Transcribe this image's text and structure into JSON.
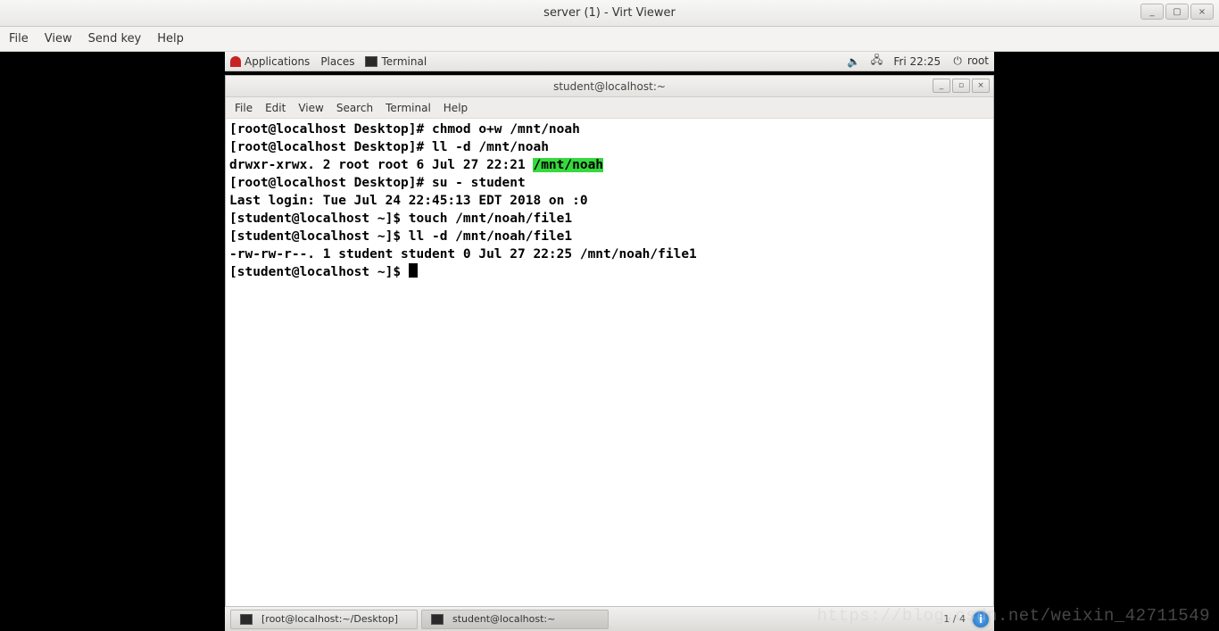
{
  "virt_viewer": {
    "title": "server (1) - Virt Viewer",
    "menus": {
      "file": "File",
      "view": "View",
      "send_key": "Send key",
      "help": "Help"
    },
    "controls": {
      "min": "_",
      "max": "▢",
      "close": "×"
    }
  },
  "gnome_top": {
    "applications": "Applications",
    "places": "Places",
    "terminal": "Terminal",
    "clock": "Fri 22:25",
    "user": "root"
  },
  "terminal": {
    "title": "student@localhost:~",
    "menus": {
      "file": "File",
      "edit": "Edit",
      "view": "View",
      "search": "Search",
      "terminal": "Terminal",
      "help": "Help"
    },
    "controls": {
      "min": "_",
      "max": "▫",
      "close": "×"
    },
    "lines": {
      "l1": "[root@localhost Desktop]# chmod o+w /mnt/noah",
      "l2": "[root@localhost Desktop]# ll -d /mnt/noah",
      "l3a": "drwxr-xrwx. 2 root root 6 Jul 27 22:21 ",
      "l3h": "/mnt/noah",
      "l4": "[root@localhost Desktop]# su - student",
      "l5": "Last login: Tue Jul 24 22:45:13 EDT 2018 on :0",
      "l6": "[student@localhost ~]$ touch /mnt/noah/file1",
      "l7": "[student@localhost ~]$ ll -d /mnt/noah/file1",
      "l8": "-rw-rw-r--. 1 student student 0 Jul 27 22:25 /mnt/noah/file1",
      "l9": "[student@localhost ~]$ "
    }
  },
  "taskbar": {
    "item1": "[root@localhost:~/Desktop]",
    "item2": "student@localhost:~",
    "workspace": "1 / 4"
  },
  "watermark": "https://blog.csdn.net/weixin_42711549"
}
